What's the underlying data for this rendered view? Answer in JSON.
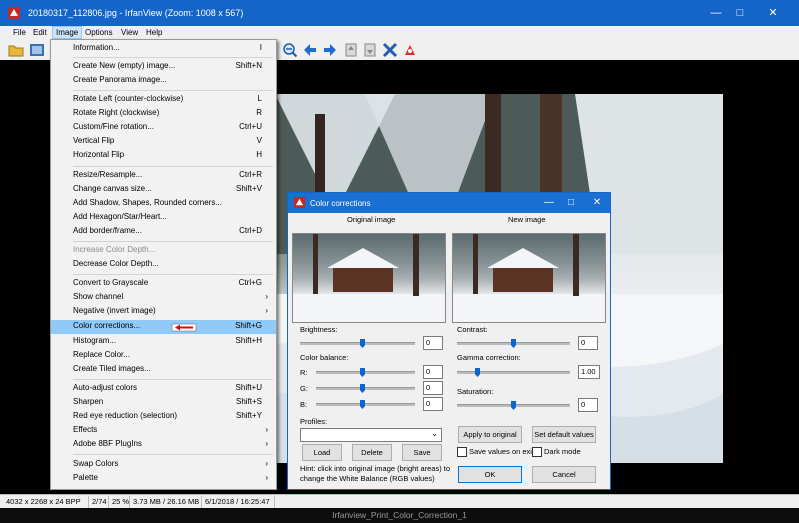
{
  "window": {
    "title": "20180317_112806.jpg - IrfanView (Zoom: 1008 x 567)"
  },
  "menubar": [
    "File",
    "Edit",
    "Image",
    "Options",
    "View",
    "Help"
  ],
  "image_menu": [
    {
      "label": "Information...",
      "shortcut": "I"
    },
    {
      "label": "Create New (empty) image...",
      "shortcut": "Shift+N"
    },
    {
      "label": "Create Panorama image...",
      "shortcut": ""
    },
    {
      "label": "Rotate Left (counter-clockwise)",
      "shortcut": "L"
    },
    {
      "label": "Rotate Right (clockwise)",
      "shortcut": "R"
    },
    {
      "label": "Custom/Fine rotation...",
      "shortcut": "Ctrl+U"
    },
    {
      "label": "Vertical Flip",
      "shortcut": "V"
    },
    {
      "label": "Horizontal Flip",
      "shortcut": "H"
    },
    {
      "label": "Resize/Resample...",
      "shortcut": "Ctrl+R"
    },
    {
      "label": "Change canvas size...",
      "shortcut": "Shift+V"
    },
    {
      "label": "Add Shadow, Shapes, Rounded corners...",
      "shortcut": ""
    },
    {
      "label": "Add Hexagon/Star/Heart...",
      "shortcut": ""
    },
    {
      "label": "Add border/frame...",
      "shortcut": "Ctrl+D"
    },
    {
      "label": "Increase Color Depth...",
      "shortcut": ""
    },
    {
      "label": "Decrease Color Depth...",
      "shortcut": ""
    },
    {
      "label": "Convert to Grayscale",
      "shortcut": "Ctrl+G"
    },
    {
      "label": "Show channel",
      "shortcut": ""
    },
    {
      "label": "Negative (invert image)",
      "shortcut": ""
    },
    {
      "label": "Color corrections...",
      "shortcut": "Shift+G"
    },
    {
      "label": "Histogram...",
      "shortcut": "Shift+H"
    },
    {
      "label": "Replace Color...",
      "shortcut": ""
    },
    {
      "label": "Create Tiled images...",
      "shortcut": ""
    },
    {
      "label": "Auto-adjust colors",
      "shortcut": "Shift+U"
    },
    {
      "label": "Sharpen",
      "shortcut": "Shift+S"
    },
    {
      "label": "Red eye reduction (selection)",
      "shortcut": "Shift+Y"
    },
    {
      "label": "Effects",
      "shortcut": ""
    },
    {
      "label": "Adobe 8BF PlugIns",
      "shortcut": ""
    },
    {
      "label": "Swap Colors",
      "shortcut": ""
    },
    {
      "label": "Palette",
      "shortcut": ""
    }
  ],
  "dialog": {
    "title": "Color corrections",
    "original_label": "Original image",
    "new_label": "New image",
    "brightness_label": "Brightness:",
    "brightness_value": "0",
    "color_balance_label": "Color balance:",
    "r_label": "R:",
    "r_value": "0",
    "g_label": "G:",
    "g_value": "0",
    "b_label": "B:",
    "b_value": "0",
    "contrast_label": "Contrast:",
    "contrast_value": "0",
    "gamma_label": "Gamma correction:",
    "gamma_value": "1.00",
    "saturation_label": "Saturation:",
    "saturation_value": "0",
    "profiles_label": "Profiles:",
    "load_btn": "Load",
    "delete_btn": "Delete",
    "save_btn": "Save",
    "apply_original_btn": "Apply to original",
    "set_default_btn": "Set default values",
    "save_on_exit_label": "Save values on exit",
    "dark_mode_label": "Dark mode",
    "hint_line1": "Hint: click into original image (bright areas) to",
    "hint_line2": "change the White Balance (RGB values)",
    "ok_btn": "OK",
    "cancel_btn": "Cancel"
  },
  "status": {
    "dims": "4032 x 2268 x 24 BPP",
    "index": "2/74",
    "zoom": "25 %",
    "size": "3.73 MB / 26.16 MB",
    "date": "6/1/2018 / 16:25:47"
  },
  "caption": "Irfanview_Print_Color_Correction_1"
}
